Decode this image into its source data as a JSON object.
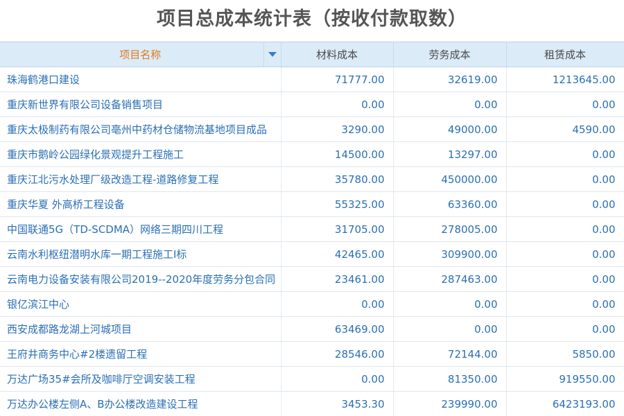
{
  "title": "项目总成本统计表（按收付款取数）",
  "columns": {
    "name": "项目名称",
    "material": "材料成本",
    "labor": "劳务成本",
    "rental": "租赁成本"
  },
  "sort_icon": "sort-down-icon",
  "colors": {
    "header_bg": "#dcebf8",
    "name_header": "#e07a1e",
    "link_text": "#2a6fb5",
    "title": "#555555"
  },
  "rows": [
    {
      "name": "珠海鹤港口建设",
      "material": "71777.00",
      "labor": "32619.00",
      "rental": "1213645.00"
    },
    {
      "name": "重庆新世界有限公司设备销售项目",
      "material": "0.00",
      "labor": "0.00",
      "rental": "0.00"
    },
    {
      "name": "重庆太极制药有限公司亳州中药材仓储物流基地项目成品",
      "material": "3290.00",
      "labor": "49000.00",
      "rental": "4590.00"
    },
    {
      "name": "重庆市鹅岭公园绿化景观提升工程施工",
      "material": "14500.00",
      "labor": "13297.00",
      "rental": "0.00"
    },
    {
      "name": "重庆江北污水处理厂级改造工程-道路修复工程",
      "material": "35780.00",
      "labor": "450000.00",
      "rental": "0.00"
    },
    {
      "name": "重庆华夏 外高桥工程设备",
      "material": "55325.00",
      "labor": "63360.00",
      "rental": "0.00"
    },
    {
      "name": "中国联通5G（TD-SCDMA）网络三期四川工程",
      "material": "31705.00",
      "labor": "278005.00",
      "rental": "0.00"
    },
    {
      "name": "云南水利枢纽潜明水库一期工程施工I标",
      "material": "42465.00",
      "labor": "309900.00",
      "rental": "0.00"
    },
    {
      "name": "云南电力设备安装有限公司2019--2020年度劳务分包合同",
      "material": "23461.00",
      "labor": "287463.00",
      "rental": "0.00"
    },
    {
      "name": "银亿滨江中心",
      "material": "0.00",
      "labor": "0.00",
      "rental": "0.00"
    },
    {
      "name": "西安成都路龙湖上河城项目",
      "material": "63469.00",
      "labor": "0.00",
      "rental": "0.00"
    },
    {
      "name": "王府井商务中心#2楼遗留工程",
      "material": "28546.00",
      "labor": "72144.00",
      "rental": "5850.00"
    },
    {
      "name": "万达广场35#会所及咖啡厅空调安装工程",
      "material": "0.00",
      "labor": "81350.00",
      "rental": "919550.00"
    },
    {
      "name": "万达办公楼左侧A、B办公楼改造建设工程",
      "material": "3453.30",
      "labor": "239990.00",
      "rental": "6423193.00"
    }
  ]
}
